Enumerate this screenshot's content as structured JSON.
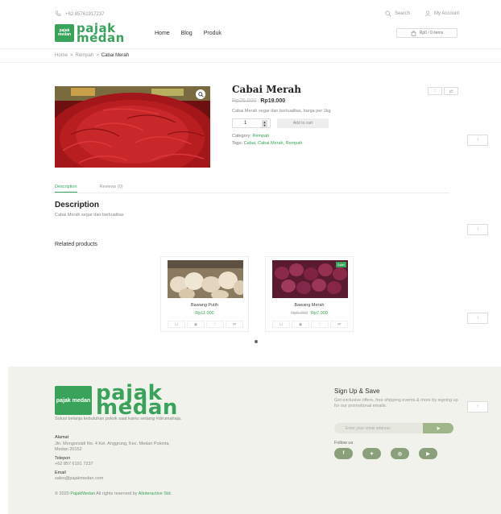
{
  "topbar": {
    "phone": "+62 85761917237",
    "search_label": "Search",
    "account_label": "My Account"
  },
  "header": {
    "logo_text_1": "pajak",
    "logo_text_2": "medan",
    "logo_bag_text": "pajak medan",
    "nav": [
      "Home",
      "Blog",
      "Produk"
    ],
    "cart_label": "Rp0 / 0 items"
  },
  "breadcrumb": {
    "home": "Home",
    "sep": ">",
    "category": "Rempah",
    "current": "Cabai Merah"
  },
  "product": {
    "title": "Cabai Merah",
    "old_price": "Rp25.000",
    "price": "Rp19.000",
    "short_desc": "Cabai Merah segar dan berkualitas, harga per 1kg",
    "quantity": "1",
    "add_to_cart": "Add to cart",
    "category_label": "Category:",
    "category": "Rempah",
    "tags_label": "Tags:",
    "tags": "Cabai, Cabai Merah, Rempah"
  },
  "tabs": {
    "description": "Description",
    "reviews": "Reviews (0)"
  },
  "description": {
    "title": "Description",
    "text": "Cabai Merah segar dan berkualitas"
  },
  "related": {
    "title": "Related products",
    "items": [
      {
        "name": "Bawang Putih",
        "old_price": "",
        "price": "Rp11.000",
        "badge": ""
      },
      {
        "name": "Bawang Merah",
        "old_price": "Rp9.000",
        "price": "Rp7.000",
        "badge": "Sale!"
      }
    ]
  },
  "footer": {
    "tagline": "Solusi belanja kebutuhan pokok saat kamu sedang #dirumahaja.",
    "address_label": "Alamat",
    "address": "Jln. Mongonsidi No. 4 Kel. Anggrung, Kec. Medan Polonia, Medan 20152",
    "phone_label": "Telepon",
    "phone": "+62 857 6191 7237",
    "email_label": "Email",
    "email": "sales@pajakmedan.com",
    "copyright_pre": "© 2020",
    "copyright_brand": "PajakMedan",
    "copyright_mid": "All rights reserved by",
    "copyright_company": "Alinteractive Std.",
    "signup_title": "Sign Up & Save",
    "signup_text": "Get exclusive offers, free shipping events & more by signing up for our promotional emails.",
    "email_placeholder": "Enter your email address",
    "follow_label": "Follow us"
  },
  "icons": {
    "phone": "phone-icon",
    "search": "search-icon",
    "account": "user-icon",
    "cart": "cart-icon",
    "zoom": "zoom-icon",
    "top": "arrow-up-icon"
  },
  "colors": {
    "brand_green": "#3aa35b",
    "footer_bg": "#f1f2ec",
    "social_green": "#8aa07a"
  }
}
